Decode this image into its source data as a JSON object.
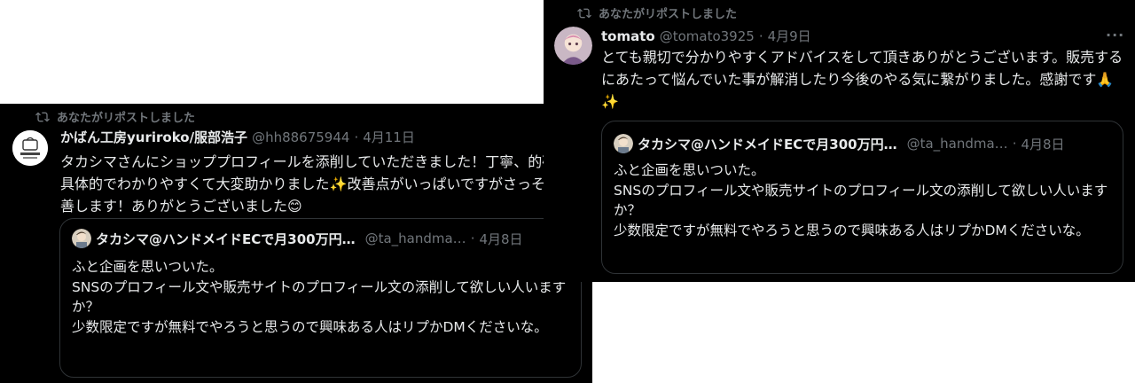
{
  "left_post": {
    "repost_label": "あなたがリポストしました",
    "author_name": "かばん工房yuriroko/服部浩子",
    "handle": "@hh88675944",
    "separator": "·",
    "date": "4月11日",
    "more_label": "···",
    "text_before_sparkle": "タカシマさんにショッププロフィールを添削していただきました！丁寧、的確、具体的でわかりやすくて大変助かりました",
    "sparkle_emoji": "✨",
    "text_after_sparkle": "改善点がいっぱいですがさっそく改善します！ありがとうございました",
    "smile_emoji": "😊",
    "quote": {
      "author_name": "タカシマ@ハンドメイドECで月300万円…",
      "handle": "@ta_handma…",
      "separator": "·",
      "date": "4月8日",
      "text": "ふと企画を思いついた。\nSNSのプロフィール文や販売サイトのプロフィール文の添削して欲しい人いますか？\n少数限定ですが無料でやろうと思うので興味ある人はリプかDMくださいな。"
    }
  },
  "right_post": {
    "repost_label": "あなたがリポストしました",
    "author_name": "tomato",
    "handle": "@tomato3925",
    "separator": "·",
    "date": "4月9日",
    "more_label": "···",
    "text": "とても親切で分かりやすくアドバイスをして頂きありがとうございます。販売するにあたって悩んでいた事が解消したり今後のやる気に繋がりました。感謝です",
    "pray_emoji": "🙏",
    "sparkle_emoji": "✨",
    "quote": {
      "author_name": "タカシマ@ハンドメイドECで月300万円…",
      "handle": "@ta_handma…",
      "separator": "·",
      "date": "4月8日",
      "text": "ふと企画を思いついた。\nSNSのプロフィール文や販売サイトのプロフィール文の添削して欲しい人いますか？\n少数限定ですが無料でやろうと思うので興味ある人はリプかDMくださいな。"
    }
  },
  "colors": {
    "background": "#000000",
    "text_primary": "#e7e9ea",
    "text_secondary": "#71767b",
    "border": "#2f3336"
  },
  "icons": {
    "repost": "repost-icon",
    "more": "more-icon"
  }
}
